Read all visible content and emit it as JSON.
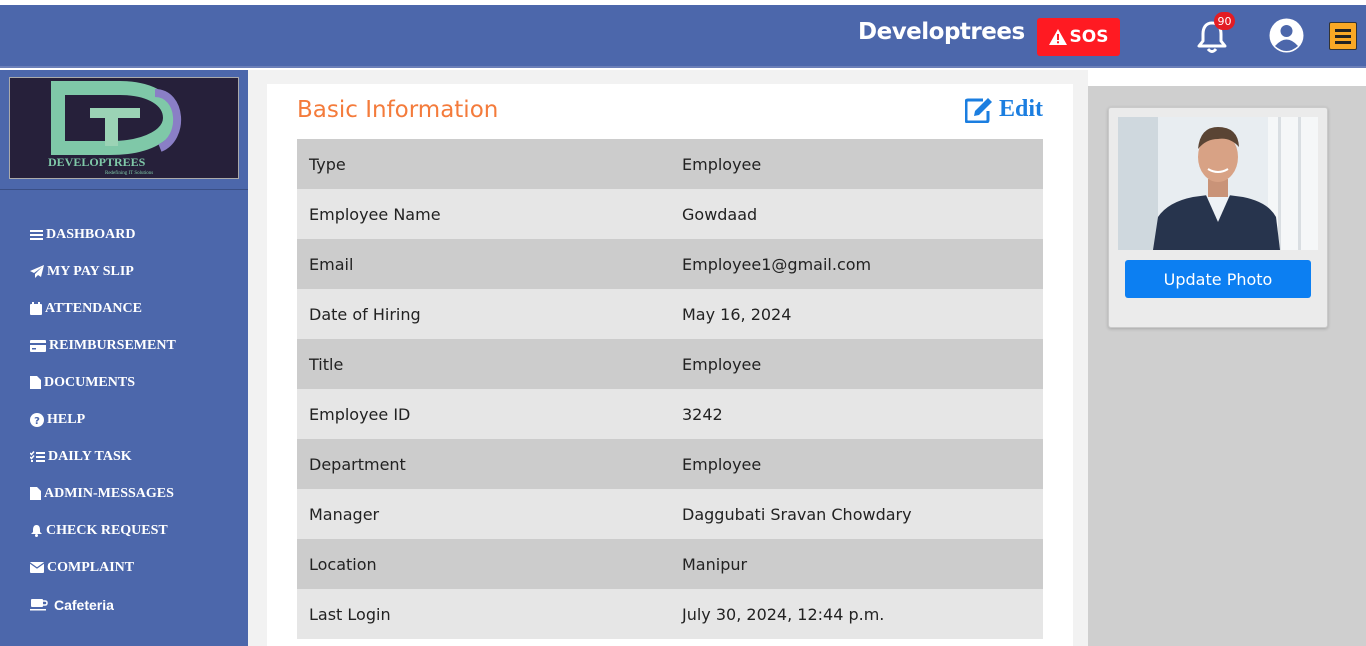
{
  "header": {
    "brand": "Developtrees",
    "sos_label": "SOS",
    "notification_count": "90"
  },
  "sidebar": {
    "logo_text": "DEVELOPTREES",
    "logo_tagline": "Redefining IT Solutions",
    "items": [
      {
        "label": "DASHBOARD",
        "icon": "bars-icon"
      },
      {
        "label": "MY PAY SLIP",
        "icon": "paper-plane-icon"
      },
      {
        "label": "ATTENDANCE",
        "icon": "calendar-icon"
      },
      {
        "label": "REIMBURSEMENT",
        "icon": "credit-card-icon"
      },
      {
        "label": "DOCUMENTS",
        "icon": "file-icon"
      },
      {
        "label": "HELP",
        "icon": "question-circle-icon"
      },
      {
        "label": "DAILY TASK",
        "icon": "list-check-icon"
      },
      {
        "label": "ADMIN-MESSAGES",
        "icon": "file-icon"
      },
      {
        "label": "CHECK REQUEST",
        "icon": "bell-icon"
      },
      {
        "label": "COMPLAINT",
        "icon": "envelope-icon"
      },
      {
        "label": "Cafeteria",
        "icon": "coffee-icon"
      }
    ]
  },
  "main": {
    "title": "Basic Information",
    "edit_label": "Edit",
    "rows": [
      {
        "key": "Type",
        "value": "Employee"
      },
      {
        "key": "Employee Name",
        "value": "Gowdaad"
      },
      {
        "key": "Email",
        "value": "Employee1@gmail.com"
      },
      {
        "key": "Date of Hiring",
        "value": "May 16, 2024"
      },
      {
        "key": "Title",
        "value": "Employee"
      },
      {
        "key": "Employee ID",
        "value": "3242"
      },
      {
        "key": "Department",
        "value": "Employee"
      },
      {
        "key": "Manager",
        "value": "Daggubati Sravan Chowdary"
      },
      {
        "key": "Location",
        "value": "Manipur"
      },
      {
        "key": "Last Login",
        "value": "July 30, 2024, 12:44 p.m."
      }
    ]
  },
  "profile": {
    "update_photo_label": "Update Photo"
  },
  "colors": {
    "header_bg": "#4c67ab",
    "accent_orange": "#f47b3b",
    "link_blue": "#1b7ee0",
    "sos_red": "#ff1a22",
    "button_blue": "#0c7ff2"
  }
}
